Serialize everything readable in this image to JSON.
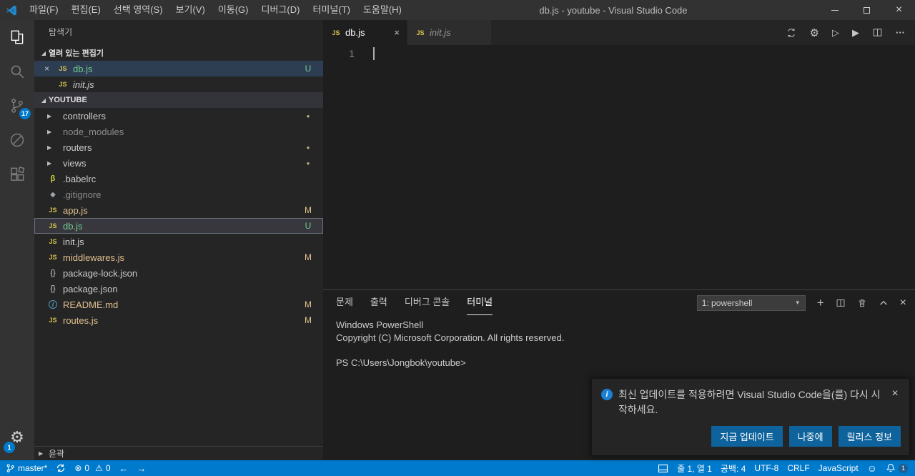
{
  "icons": {
    "close": "×",
    "chevron_expanded": "◢",
    "chevron_collapsed": "▶",
    "gear": "⚙",
    "play_outline": "▷",
    "play_filled": "▶",
    "more": "···",
    "dot": "●",
    "plus": "+",
    "dropdown": "▼",
    "error": "⊗",
    "warning": "⚠",
    "back": "←",
    "forward": "→",
    "smiley": "☺",
    "js": "JS",
    "json": "{}",
    "babel": "β",
    "git": "◆",
    "md": "i",
    "minimize": "─"
  },
  "title_bar": {
    "title": "db.js - youtube - Visual Studio Code",
    "menus": [
      "파일(F)",
      "편집(E)",
      "선택 영역(S)",
      "보기(V)",
      "이동(G)",
      "디버그(D)",
      "터미널(T)",
      "도움말(H)"
    ]
  },
  "activity_bar": {
    "scm_badge": "17",
    "settings_badge": "1"
  },
  "sidebar": {
    "title": "탐색기",
    "open_editors": {
      "header": "열려 있는 편집기",
      "items": [
        {
          "name": "db.js",
          "kind": "js",
          "badge": "U",
          "git": "untracked",
          "selected": true
        },
        {
          "name": "init.js",
          "kind": "js",
          "badge": "",
          "git": "",
          "preview": true
        }
      ]
    },
    "workspace": {
      "header": "YOUTUBE",
      "items": [
        {
          "name": "controllers",
          "kind": "folder",
          "badge": "●"
        },
        {
          "name": "node_modules",
          "kind": "folder",
          "git": "ignored"
        },
        {
          "name": "routers",
          "kind": "folder",
          "badge": "●"
        },
        {
          "name": "views",
          "kind": "folder",
          "badge": "●"
        },
        {
          "name": ".babelrc",
          "kind": "babel"
        },
        {
          "name": ".gitignore",
          "kind": "git",
          "git": "ignored"
        },
        {
          "name": "app.js",
          "kind": "js",
          "badge": "M",
          "git": "modified"
        },
        {
          "name": "db.js",
          "kind": "js",
          "badge": "U",
          "git": "untracked",
          "selected": true
        },
        {
          "name": "init.js",
          "kind": "js"
        },
        {
          "name": "middlewares.js",
          "kind": "js",
          "badge": "M",
          "git": "modified"
        },
        {
          "name": "package-lock.json",
          "kind": "json"
        },
        {
          "name": "package.json",
          "kind": "json"
        },
        {
          "name": "README.md",
          "kind": "md",
          "badge": "M",
          "git": "modified"
        },
        {
          "name": "routes.js",
          "kind": "js",
          "badge": "M",
          "git": "modified"
        }
      ]
    },
    "outline_header": "윤곽"
  },
  "editor": {
    "tabs": [
      {
        "label": "db.js",
        "active": true
      },
      {
        "label": "init.js",
        "preview": true
      }
    ],
    "line_number": "1"
  },
  "panel": {
    "tabs": [
      {
        "label": "문제"
      },
      {
        "label": "출력"
      },
      {
        "label": "디버그 콘솔"
      },
      {
        "label": "터미널",
        "active": true
      }
    ],
    "terminal_picker": "1: powershell",
    "terminal_lines": [
      "Windows PowerShell",
      "Copyright (C) Microsoft Corporation. All rights reserved.",
      "",
      "PS C:\\Users\\Jongbok\\youtube>"
    ]
  },
  "notification": {
    "message": "최신 업데이트를 적용하려면 Visual Studio Code을(를) 다시 시작하세요.",
    "buttons": [
      "지금 업데이트",
      "나중에",
      "릴리스 정보"
    ]
  },
  "status_bar": {
    "branch": "master*",
    "errors": "0",
    "warnings": "0",
    "cursor": "줄 1, 열 1",
    "indent": "공백: 4",
    "encoding": "UTF-8",
    "eol": "CRLF",
    "language": "JavaScript",
    "bell_badge": "1"
  },
  "colors": {
    "status_bar": "#007acc",
    "badge": "#007acc",
    "button": "#0e639c",
    "git_modified": "#e2c08d",
    "git_untracked": "#73c991",
    "git_ignored": "#8c8c8c"
  }
}
